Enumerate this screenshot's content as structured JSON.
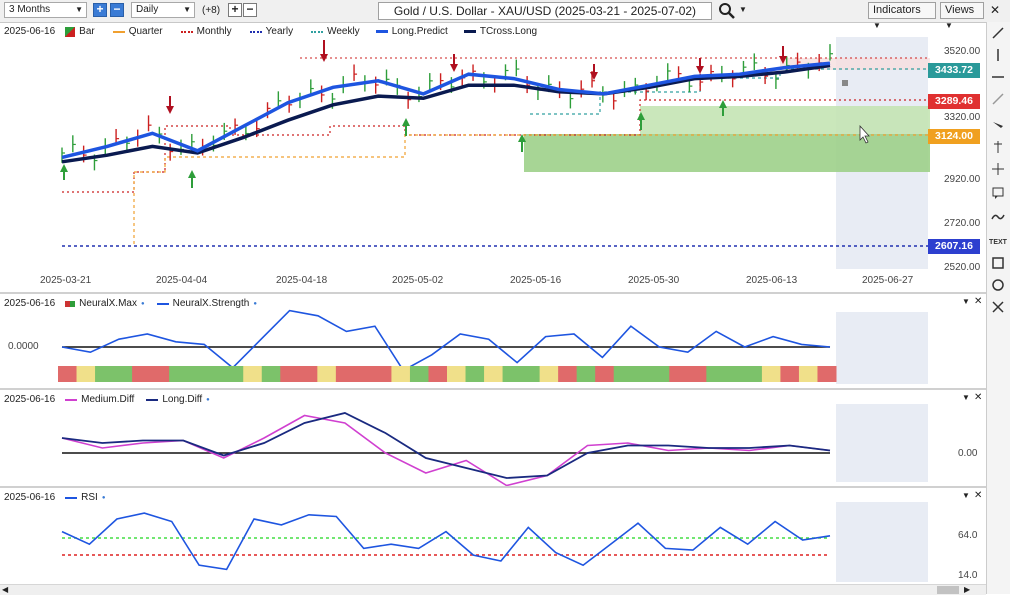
{
  "toolbar": {
    "range": "3 Months",
    "interval": "Daily",
    "offset": "(+8)",
    "plus": "+",
    "minus": "−",
    "title": "Gold / U.S. Dollar - XAU/USD (2025-03-21 - 2025-07-02)",
    "indicators": "Indicators",
    "views": "Views",
    "search_icon": "magnifier-icon",
    "dropdown_icon": "chevron-down-icon",
    "close_label": "✕"
  },
  "main": {
    "date": "2025-06-16",
    "legend": [
      {
        "label": "Bar",
        "color": "#2e9e3a",
        "style": "bar"
      },
      {
        "label": "Quarter",
        "color": "#f0a030",
        "style": "dash"
      },
      {
        "label": "Monthly",
        "color": "#cc2020",
        "style": "dot"
      },
      {
        "label": "Yearly",
        "color": "#2030b0",
        "style": "dot"
      },
      {
        "label": "Weekly",
        "color": "#30a0a0",
        "style": "dot"
      },
      {
        "label": "Long.Predict",
        "color": "#1e55e0",
        "style": "solid"
      },
      {
        "label": "TCross.Long",
        "color": "#0a1a50",
        "style": "solid"
      }
    ],
    "price_axis": [
      "3520.00",
      "3320.00",
      "3120.00",
      "2920.00",
      "2720.00",
      "2520.00"
    ],
    "price_tags": [
      {
        "value": "3433.72",
        "color": "#2a9a9a"
      },
      {
        "value": "3289.46",
        "color": "#e03030"
      },
      {
        "value": "3124.00",
        "color": "#f0a020"
      },
      {
        "value": "2607.16",
        "color": "#2d3fcf"
      }
    ],
    "dates": [
      "2025-03-21",
      "2025-04-04",
      "2025-04-18",
      "2025-05-02",
      "2025-05-16",
      "2025-05-30",
      "2025-06-13",
      "2025-06-27"
    ]
  },
  "neural": {
    "date": "2025-06-16",
    "legend": [
      {
        "label": "NeuralX.Max",
        "color": "#cc3333"
      },
      {
        "label": "NeuralX.Strength",
        "color": "#1e55e0"
      }
    ],
    "zero_label": "0.0000"
  },
  "diff": {
    "date": "2025-06-16",
    "legend": [
      {
        "label": "Medium.Diff",
        "color": "#d040d0"
      },
      {
        "label": "Long.Diff",
        "color": "#1a2a80"
      }
    ],
    "axis": [
      "0.00"
    ]
  },
  "rsi": {
    "date": "2025-06-16",
    "legend": [
      {
        "label": "RSI",
        "color": "#1e55e0"
      }
    ],
    "axis": [
      "64.0",
      "14.0"
    ]
  },
  "chart_data": [
    {
      "type": "line",
      "title": "Gold / U.S. Dollar - XAU/USD (2025-03-21 - 2025-07-02)",
      "x": [
        "2025-03-21",
        "2025-04-04",
        "2025-04-18",
        "2025-05-02",
        "2025-05-16",
        "2025-05-30",
        "2025-06-13",
        "2025-06-27"
      ],
      "ylim": [
        2500,
        3560
      ],
      "levels": {
        "Weekly": 3433.72,
        "Monthly": 3289.46,
        "Quarter": 3124.0,
        "Yearly": 2607.16
      },
      "series": [
        {
          "name": "Long.Predict",
          "values": [
            3010,
            3060,
            3120,
            3040,
            3150,
            3260,
            3330,
            3360,
            3300,
            3390,
            3370,
            3320,
            3300,
            3340,
            3380,
            3390,
            3420,
            3440
          ]
        },
        {
          "name": "TCross.Long",
          "values": [
            2990,
            3020,
            3060,
            3030,
            3100,
            3180,
            3250,
            3290,
            3280,
            3340,
            3340,
            3310,
            3300,
            3330,
            3370,
            3380,
            3400,
            3430
          ]
        }
      ]
    },
    {
      "type": "line",
      "series": [
        {
          "name": "NeuralX.Strength",
          "values": [
            0.0,
            -0.2,
            0.3,
            0.5,
            0.2,
            0.1,
            -0.8,
            0.3,
            1.4,
            1.2,
            0.6,
            0.8,
            -0.9,
            -0.3,
            0.5,
            0.3,
            -0.6,
            0.4,
            0.5,
            -0.4,
            0.8,
            0.0,
            -0.2,
            0.6,
            0.0,
            0.4,
            0.1,
            0.0
          ]
        }
      ]
    },
    {
      "type": "line",
      "series": [
        {
          "name": "Medium.Diff",
          "values": [
            0.6,
            0.2,
            0.4,
            0.5,
            -0.2,
            0.6,
            1.5,
            1.2,
            0.0,
            -0.8,
            -0.3,
            -1.3,
            -0.9,
            0.3,
            0.4,
            0.1,
            0.2,
            0.1,
            0.3,
            0.1
          ]
        },
        {
          "name": "Long.Diff",
          "values": [
            0.6,
            0.4,
            0.5,
            0.5,
            -0.1,
            0.4,
            1.2,
            1.6,
            0.8,
            -0.2,
            -0.6,
            -1.0,
            -0.9,
            0.0,
            0.3,
            0.3,
            0.2,
            0.2,
            0.3,
            0.1
          ]
        }
      ]
    },
    {
      "type": "line",
      "series": [
        {
          "name": "RSI",
          "values": [
            60,
            45,
            75,
            82,
            72,
            20,
            15,
            75,
            68,
            80,
            78,
            40,
            45,
            40,
            60,
            32,
            25,
            65,
            35,
            20,
            45,
            70,
            40,
            38,
            65,
            45,
            72,
            50,
            55
          ]
        }
      ]
    }
  ]
}
